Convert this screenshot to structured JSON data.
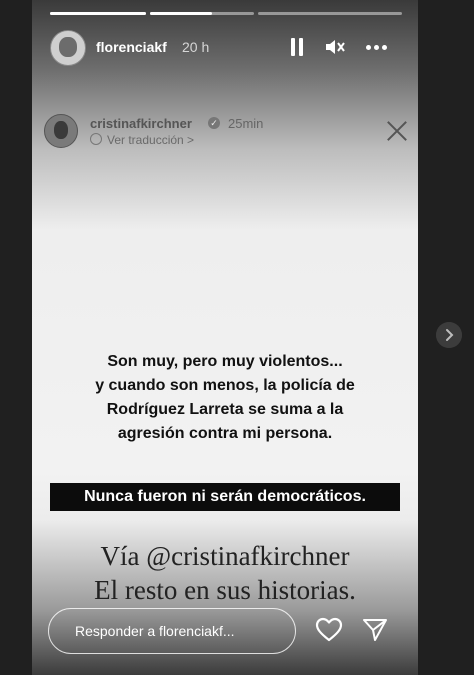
{
  "header": {
    "username": "florenciakf",
    "time": "20 h",
    "progress_segments": [
      1,
      0.6,
      0
    ]
  },
  "embedded_post": {
    "username": "cristinafkirchner",
    "time": "25min",
    "translate_label": "Ver traducción >"
  },
  "content": {
    "lines": [
      "Son muy, pero muy violentos...",
      "y cuando son menos, la policía de",
      "Rodríguez Larreta se suma a la",
      "agresión contra mi persona."
    ],
    "banner": "Nunca fueron ni serán democráticos.",
    "via_line1": "Vía @cristinafkirchner",
    "via_line2": "El resto en sus historias."
  },
  "footer": {
    "reply_placeholder": "Responder a florenciakf..."
  },
  "colors": {
    "banner_bg": "#0c0c0c",
    "page_bg": "#202020"
  }
}
